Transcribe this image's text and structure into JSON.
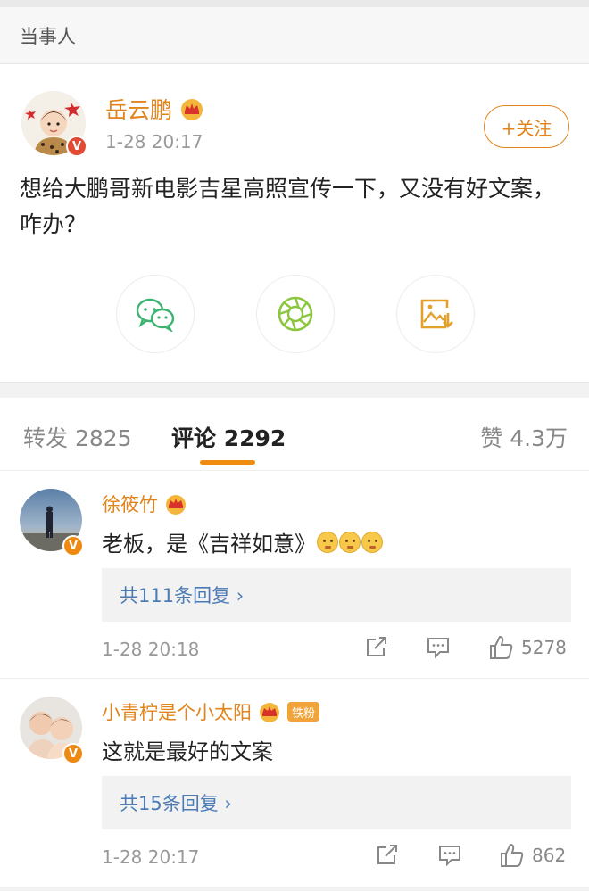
{
  "header": {
    "title": "当事人"
  },
  "post": {
    "username": "岳云鹏",
    "time": "1-28 20:17",
    "follow_label": "+关注",
    "text": "想给大鹏哥新电影吉星高照宣传一下，又没有好文案，咋办？",
    "verify_badge": "V",
    "share_icons": [
      "wechat-icon",
      "moments-icon",
      "save-image-icon"
    ]
  },
  "tabs": {
    "repost": "转发 2825",
    "comments": "评论 2292",
    "likes": "赞 4.3万"
  },
  "comments": [
    {
      "name": "徐筱竹",
      "text": "老板，是《吉祥如意》",
      "replies": "共111条回复 ›",
      "time": "1-28 20:18",
      "likes": "5278",
      "verify_badge": "V"
    },
    {
      "name": "小青柠是个小太阳",
      "fan_badge": "铁粉",
      "text": "这就是最好的文案",
      "replies": "共15条回复 ›",
      "time": "1-28 20:17",
      "likes": "862",
      "verify_badge": "V"
    }
  ],
  "colors": {
    "accent": "#e2841b",
    "link": "#4b7bb5",
    "tab_underline": "#f08c10"
  }
}
